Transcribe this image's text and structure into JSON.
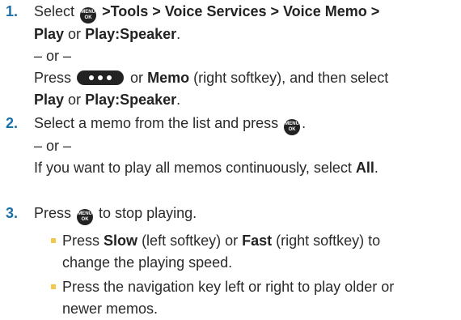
{
  "step1": {
    "number": "1.",
    "select": "Select",
    "path": ">Tools > Voice Services > Voice Memo >",
    "play": "Play",
    "or1": "or",
    "play_speaker": "Play:Speaker",
    "period": ".",
    "or_separator": "– or –",
    "press": "Press",
    "or2": "or",
    "memo": "Memo",
    "memo_suffix": "(right softkey), and then select",
    "play2": "Play",
    "or3": "or",
    "play_speaker2": "Play:Speaker",
    "period2": "."
  },
  "step2": {
    "number": "2.",
    "text": "Select a memo from the list and press",
    "period": ".",
    "or_separator": "– or –",
    "text2": "If you want to play all memos continuously, select",
    "all": "All",
    "period2": "."
  },
  "step3": {
    "number": "3.",
    "press": "Press",
    "text": "to stop playing."
  },
  "bullets": [
    {
      "before": "Press",
      "slow": "Slow",
      "mid": "(left softkey) or",
      "fast": "Fast",
      "after": "(right softkey) to",
      "line2": "change the playing speed."
    },
    {
      "line1": "Press the navigation key left or right to play older or",
      "line2": "newer memos."
    }
  ],
  "menu_key": {
    "top": "MENU",
    "bottom": "OK"
  }
}
